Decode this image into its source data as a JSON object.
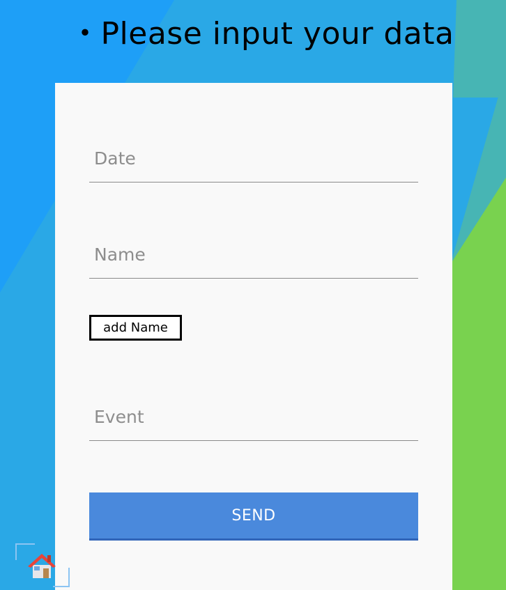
{
  "header": {
    "title": "・Please input your data"
  },
  "form": {
    "date_placeholder": "Date",
    "name_placeholder": "Name",
    "add_name_label": "add Name",
    "event_placeholder": "Event",
    "send_label": "SEND"
  },
  "icons": {
    "home": "home-icon"
  },
  "colors": {
    "bg_blue": "#25a5f5",
    "bg_teal": "#45b6b2",
    "bg_green": "#79d24f",
    "card": "#f9f9f9",
    "send_button": "#4a89dc"
  }
}
